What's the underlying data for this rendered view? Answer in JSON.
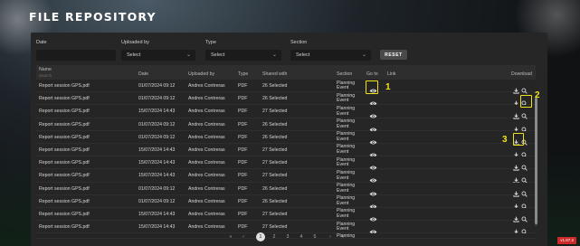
{
  "page": {
    "title": "FILE REPOSITORY"
  },
  "filters": [
    {
      "label": "Date",
      "value": ""
    },
    {
      "label": "Uploaded by",
      "value": "Select"
    },
    {
      "label": "Type",
      "value": "Select"
    },
    {
      "label": "Section",
      "value": "Select"
    }
  ],
  "reset_label": "RESET",
  "table": {
    "headers": {
      "name": "Name",
      "name_search": "Search",
      "date": "Date",
      "uploaded_by": "Uploaded by",
      "type": "Type",
      "shared_with": "Shared with",
      "section": "Section",
      "go_to": "Go to",
      "link": "Link",
      "download": "Download"
    },
    "rows": [
      {
        "name": "Report session GPS.pdf",
        "date": "01/07/2024 09:12",
        "uploaded_by": "Andres Contreras",
        "type": "PDF",
        "shared_with": "26 Selected",
        "section_1": "Planning",
        "section_2": "Event"
      },
      {
        "name": "Report session GPS.pdf",
        "date": "01/07/2024 09:12",
        "uploaded_by": "Andres Contreras",
        "type": "PDF",
        "shared_with": "26 Selected",
        "section_1": "Planning",
        "section_2": "Event"
      },
      {
        "name": "Report session GPS.pdf",
        "date": "15/07/2024 14:43",
        "uploaded_by": "Andres Contreras",
        "type": "PDF",
        "shared_with": "27 Selected",
        "section_1": "Planning",
        "section_2": "Event"
      },
      {
        "name": "Report session GPS.pdf",
        "date": "01/07/2024 09:12",
        "uploaded_by": "Andres Contreras",
        "type": "PDF",
        "shared_with": "26 Selected",
        "section_1": "Planning",
        "section_2": "Event"
      },
      {
        "name": "Report session GPS.pdf",
        "date": "01/07/2024 09:12",
        "uploaded_by": "Andres Contreras",
        "type": "PDF",
        "shared_with": "26 Selected",
        "section_1": "Planning",
        "section_2": "Event"
      },
      {
        "name": "Report session GPS.pdf",
        "date": "15/07/2024 14:43",
        "uploaded_by": "Andres Contreras",
        "type": "PDF",
        "shared_with": "27 Selected",
        "section_1": "Planning",
        "section_2": "Event"
      },
      {
        "name": "Report session GPS.pdf",
        "date": "15/07/2024 14:43",
        "uploaded_by": "Andres Contreras",
        "type": "PDF",
        "shared_with": "27 Selected",
        "section_1": "Planning",
        "section_2": "Event"
      },
      {
        "name": "Report session GPS.pdf",
        "date": "15/07/2024 14:43",
        "uploaded_by": "Andres Contreras",
        "type": "PDF",
        "shared_with": "27 Selected",
        "section_1": "Planning",
        "section_2": "Event"
      },
      {
        "name": "Report session GPS.pdf",
        "date": "01/07/2024 09:12",
        "uploaded_by": "Andres Contreras",
        "type": "PDF",
        "shared_with": "26 Selected",
        "section_1": "Planning",
        "section_2": "Event"
      },
      {
        "name": "Report session GPS.pdf",
        "date": "01/07/2024 09:12",
        "uploaded_by": "Andres Contreras",
        "type": "PDF",
        "shared_with": "26 Selected",
        "section_1": "Planning",
        "section_2": "Event"
      },
      {
        "name": "Report session GPS.pdf",
        "date": "15/07/2024 14:43",
        "uploaded_by": "Andres Contreras",
        "type": "PDF",
        "shared_with": "27 Selected",
        "section_1": "Planning",
        "section_2": "Event"
      },
      {
        "name": "Report session GPS.pdf",
        "date": "15/07/2024 14:43",
        "uploaded_by": "Andres Contreras",
        "type": "PDF",
        "shared_with": "27 Selected",
        "section_1": "Planning",
        "section_2": "Event"
      }
    ],
    "partial_row_section": "Planning"
  },
  "annotations": [
    {
      "number": "1",
      "target": "go-to-eye-icon"
    },
    {
      "number": "2",
      "target": "download-search-icon"
    },
    {
      "number": "3",
      "target": "download-icon"
    }
  ],
  "pagination": {
    "first": "«",
    "prev": "‹",
    "pages": [
      "1",
      "2",
      "3",
      "4",
      "5"
    ],
    "current": "1",
    "next": "›",
    "last": "»"
  },
  "version_badge": "v1.87.2",
  "colors": {
    "highlight": "#f2e21c",
    "panel": "#262626",
    "badge": "#cc2a2a"
  },
  "icons": {
    "go_to": "eye-icon",
    "download": "download-icon",
    "preview": "search-icon",
    "dropdown": "chevron-down-icon"
  }
}
